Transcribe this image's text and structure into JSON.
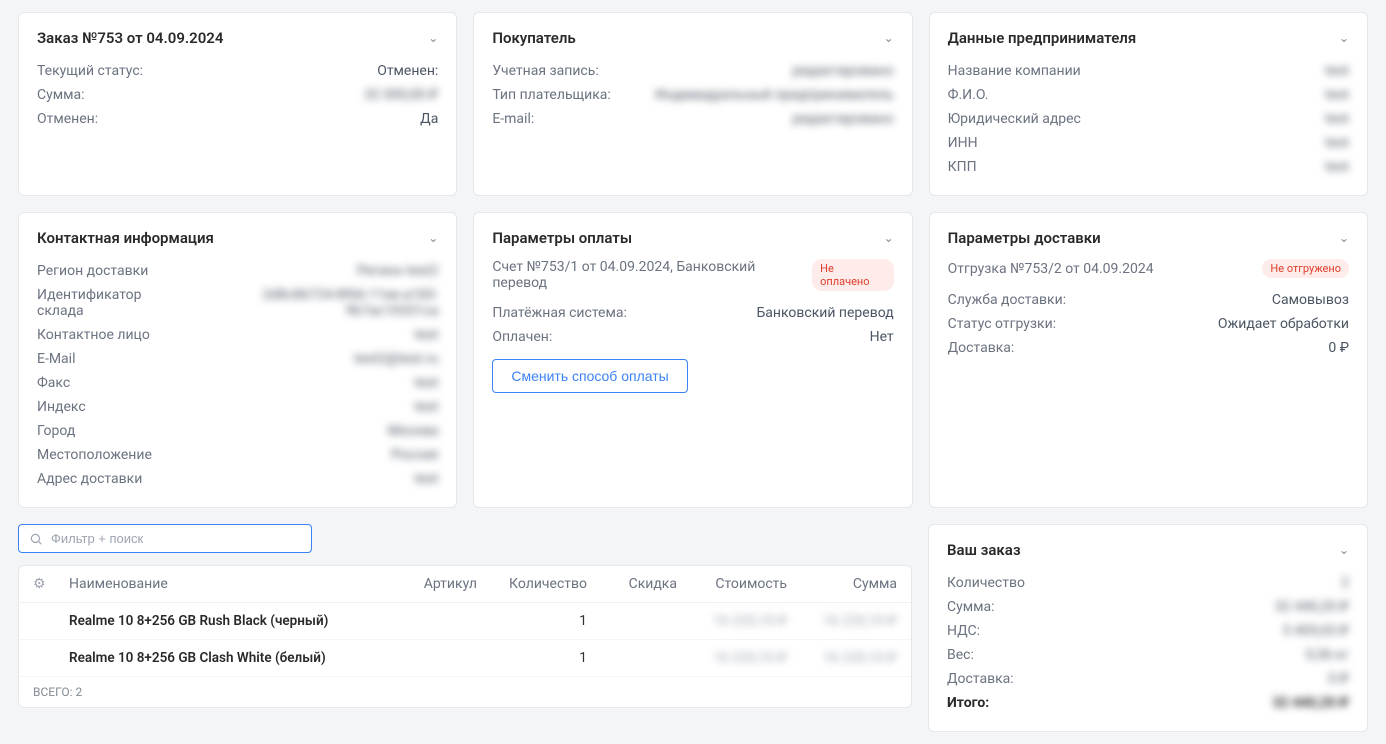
{
  "cards": {
    "order": {
      "title": "Заказ №753 от 04.09.2024",
      "rows": [
        {
          "k": "Текущий статус:",
          "v": "Отменен:",
          "blur": false
        },
        {
          "k": "Сумма:",
          "v": "32 000,00 ₽",
          "blur": true
        },
        {
          "k": "Отменен:",
          "v": "Да",
          "blur": false
        }
      ]
    },
    "buyer": {
      "title": "Покупатель",
      "rows": [
        {
          "k": "Учетная запись:",
          "v": "редактировано",
          "blur": true
        },
        {
          "k": "Тип плательщика:",
          "v": "Индивидуальный предприниматель",
          "blur": true
        },
        {
          "k": "E-mail:",
          "v": "редактировано",
          "blur": true
        }
      ]
    },
    "entrepreneur": {
      "title": "Данные предпринимателя",
      "rows": [
        {
          "k": "Название компании",
          "v": "test",
          "blur": true
        },
        {
          "k": "Ф.И.О.",
          "v": "test",
          "blur": true
        },
        {
          "k": "Юридический адрес",
          "v": "test",
          "blur": true
        },
        {
          "k": "ИНН",
          "v": "test",
          "blur": true
        },
        {
          "k": "КПП",
          "v": "test",
          "blur": true
        }
      ]
    },
    "contact": {
      "title": "Контактная информация",
      "rows": [
        {
          "k": "Регион доставки",
          "v": "Регион test2",
          "blur": true
        },
        {
          "k": "Идентификатор склада",
          "v": "2d8c86724-8f66-11ee-a183-9b7ac10331ca",
          "blur": true
        },
        {
          "k": "Контактное лицо",
          "v": "test",
          "blur": true
        },
        {
          "k": "E-Mail",
          "v": "test2@test.ru",
          "blur": true
        },
        {
          "k": "Факс",
          "v": "test",
          "blur": true
        },
        {
          "k": "Индекс",
          "v": "test",
          "blur": true
        },
        {
          "k": "Город",
          "v": "Москва",
          "blur": true
        },
        {
          "k": "Местоположение",
          "v": "Россия",
          "blur": true
        },
        {
          "k": "Адрес доставки",
          "v": "test",
          "blur": true
        }
      ]
    },
    "payment": {
      "title": "Параметры оплаты",
      "sub": "Счет №753/1 от 04.09.2024, Банковский перевод",
      "badge": "Не оплачено",
      "rows": [
        {
          "k": "Платёжная система:",
          "v": "Банковский перевод",
          "blur": false
        },
        {
          "k": "Оплачен:",
          "v": "Нет",
          "blur": false
        }
      ],
      "button": "Сменить способ оплаты"
    },
    "delivery": {
      "title": "Параметры доставки",
      "sub": "Отгрузка №753/2 от 04.09.2024",
      "badge": "Не отгружено",
      "rows": [
        {
          "k": "Служба доставки:",
          "v": "Самовывоз",
          "blur": false
        },
        {
          "k": "Статус отгрузки:",
          "v": "Ожидает обработки",
          "blur": false
        },
        {
          "k": "Доставка:",
          "v": "0 ₽",
          "blur": false
        }
      ]
    }
  },
  "search": {
    "placeholder": "Фильтр + поиск"
  },
  "table": {
    "headers": {
      "name": "Наименование",
      "sku": "Артикул",
      "qty": "Количество",
      "discount": "Скидка",
      "price": "Стоимость",
      "sum": "Сумма"
    },
    "rows": [
      {
        "name": "Realme 10 8+256 GB Rush Black (черный)",
        "sku": "",
        "qty": "1",
        "discount": "",
        "price": "16 220,10 ₽",
        "sum": "16 220,10 ₽"
      },
      {
        "name": "Realme 10 8+256 GB Clash White (белый)",
        "sku": "",
        "qty": "1",
        "discount": "",
        "price": "16 220,10 ₽",
        "sum": "16 220,10 ₽"
      }
    ],
    "footer_label": "ВСЕГО:",
    "footer_count": "2"
  },
  "summary": {
    "title": "Ваш заказ",
    "rows": [
      {
        "k": "Количество",
        "v": "2",
        "blur": true
      },
      {
        "k": "Сумма:",
        "v": "32 440,20 ₽",
        "blur": true
      },
      {
        "k": "НДС:",
        "v": "5 405,03 ₽",
        "blur": true
      },
      {
        "k": "Вес:",
        "v": "0,36 кг",
        "blur": true
      },
      {
        "k": "Доставка:",
        "v": "0 ₽",
        "blur": true
      }
    ],
    "total": {
      "k": "Итого:",
      "v": "32 440,20 ₽",
      "blur": true
    }
  }
}
